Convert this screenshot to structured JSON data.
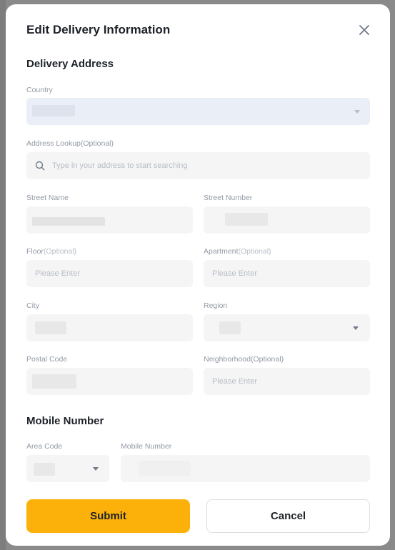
{
  "dialog": {
    "title": "Edit Delivery Information",
    "close_icon": "close-icon"
  },
  "delivery": {
    "section_title": "Delivery Address",
    "country": {
      "label": "Country",
      "value": ""
    },
    "address_lookup": {
      "label": "Address Lookup",
      "optional": "(Optional)",
      "placeholder": "Type in your address to start searching",
      "icon": "search-icon"
    },
    "street_name": {
      "label": "Street Name",
      "value": ""
    },
    "street_number": {
      "label": "Street Number",
      "value": ""
    },
    "floor": {
      "label": "Floor",
      "optional": "(Optional)",
      "placeholder": "Please Enter"
    },
    "apartment": {
      "label": "Apartment",
      "optional": "(Optional)",
      "placeholder": "Please Enter"
    },
    "city": {
      "label": "City",
      "value": ""
    },
    "region": {
      "label": "Region",
      "value": ""
    },
    "postal_code": {
      "label": "Postal Code",
      "value": ""
    },
    "neighborhood": {
      "label": "Neighborhood",
      "optional": "(Optional)",
      "placeholder": "Please Enter"
    }
  },
  "mobile": {
    "section_title": "Mobile Number",
    "area_code": {
      "label": "Area Code",
      "value": ""
    },
    "mobile_number": {
      "label": "Mobile Number",
      "value": ""
    }
  },
  "actions": {
    "submit_label": "Submit",
    "cancel_label": "Cancel"
  },
  "colors": {
    "primary": "#fcb00a",
    "text": "#1e2329",
    "muted": "#929aa5",
    "field_bg": "#f5f5f5",
    "country_bg": "#eaeef6"
  }
}
